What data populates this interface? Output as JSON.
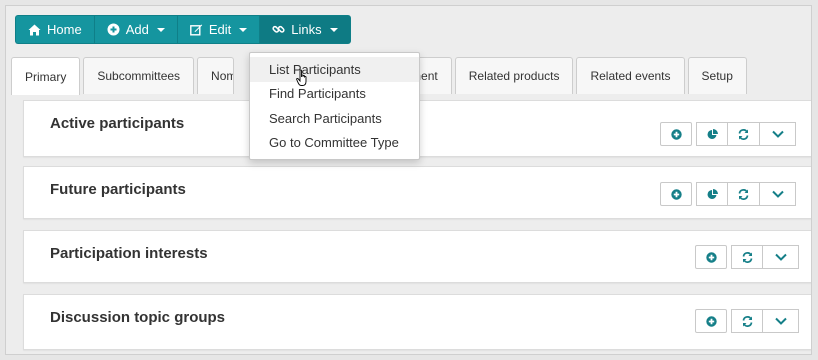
{
  "toolbar": {
    "home": "Home",
    "add": "Add",
    "edit": "Edit",
    "links": "Links"
  },
  "tabs": [
    {
      "label": "Primary"
    },
    {
      "label": "Subcommittees"
    },
    {
      "label": "Nomi"
    },
    {
      "label": "ment"
    },
    {
      "label": "Related products"
    },
    {
      "label": "Related events"
    },
    {
      "label": "Setup"
    }
  ],
  "links_menu": {
    "items": [
      {
        "label": "List Participants"
      },
      {
        "label": "Find Participants"
      },
      {
        "label": "Search Participants"
      },
      {
        "label": "Go to Committee Type"
      }
    ]
  },
  "panels": [
    {
      "title": "Active participants"
    },
    {
      "title": "Future participants"
    },
    {
      "title": "Participation interests"
    },
    {
      "title": "Discussion topic groups"
    }
  ],
  "colors": {
    "toolbar_bg": "#15959f",
    "toolbar_active": "#0e7b84",
    "icon_teal": "#157f88"
  }
}
